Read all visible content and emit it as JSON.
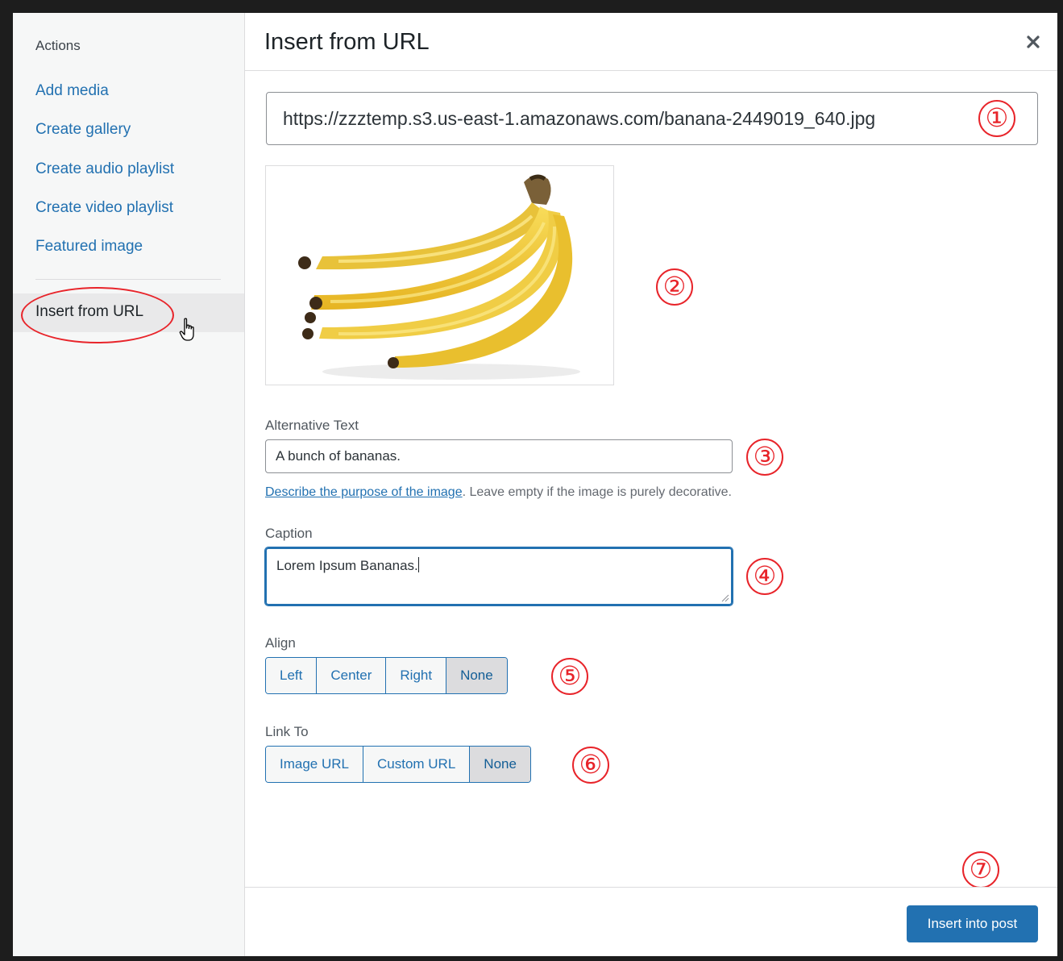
{
  "sidebar": {
    "heading": "Actions",
    "items": [
      {
        "label": "Add media"
      },
      {
        "label": "Create gallery"
      },
      {
        "label": "Create audio playlist"
      },
      {
        "label": "Create video playlist"
      },
      {
        "label": "Featured image"
      }
    ],
    "active_item": "Insert from URL"
  },
  "header": {
    "title": "Insert from URL",
    "close_icon": "close-icon"
  },
  "url_field": {
    "value": "https://zzztemp.s3.us-east-1.amazonaws.com/banana-2449019_640.jpg"
  },
  "alt_text": {
    "label": "Alternative Text",
    "value": "A bunch of bananas.",
    "help_link": "Describe the purpose of the image",
    "help_rest": ". Leave empty if the image is purely decorative."
  },
  "caption": {
    "label": "Caption",
    "value": "Lorem Ipsum Bananas."
  },
  "align": {
    "label": "Align",
    "options": [
      "Left",
      "Center",
      "Right",
      "None"
    ],
    "selected": "None"
  },
  "link_to": {
    "label": "Link To",
    "options": [
      "Image URL",
      "Custom URL",
      "None"
    ],
    "selected": "None"
  },
  "footer": {
    "insert_button": "Insert into post"
  },
  "annotations": [
    "①",
    "②",
    "③",
    "④",
    "⑤",
    "⑥",
    "⑦"
  ],
  "colors": {
    "accent": "#2271b1",
    "annotation": "#e8242a",
    "banana": "#f2c935",
    "sidebar_bg": "#f6f7f7"
  }
}
